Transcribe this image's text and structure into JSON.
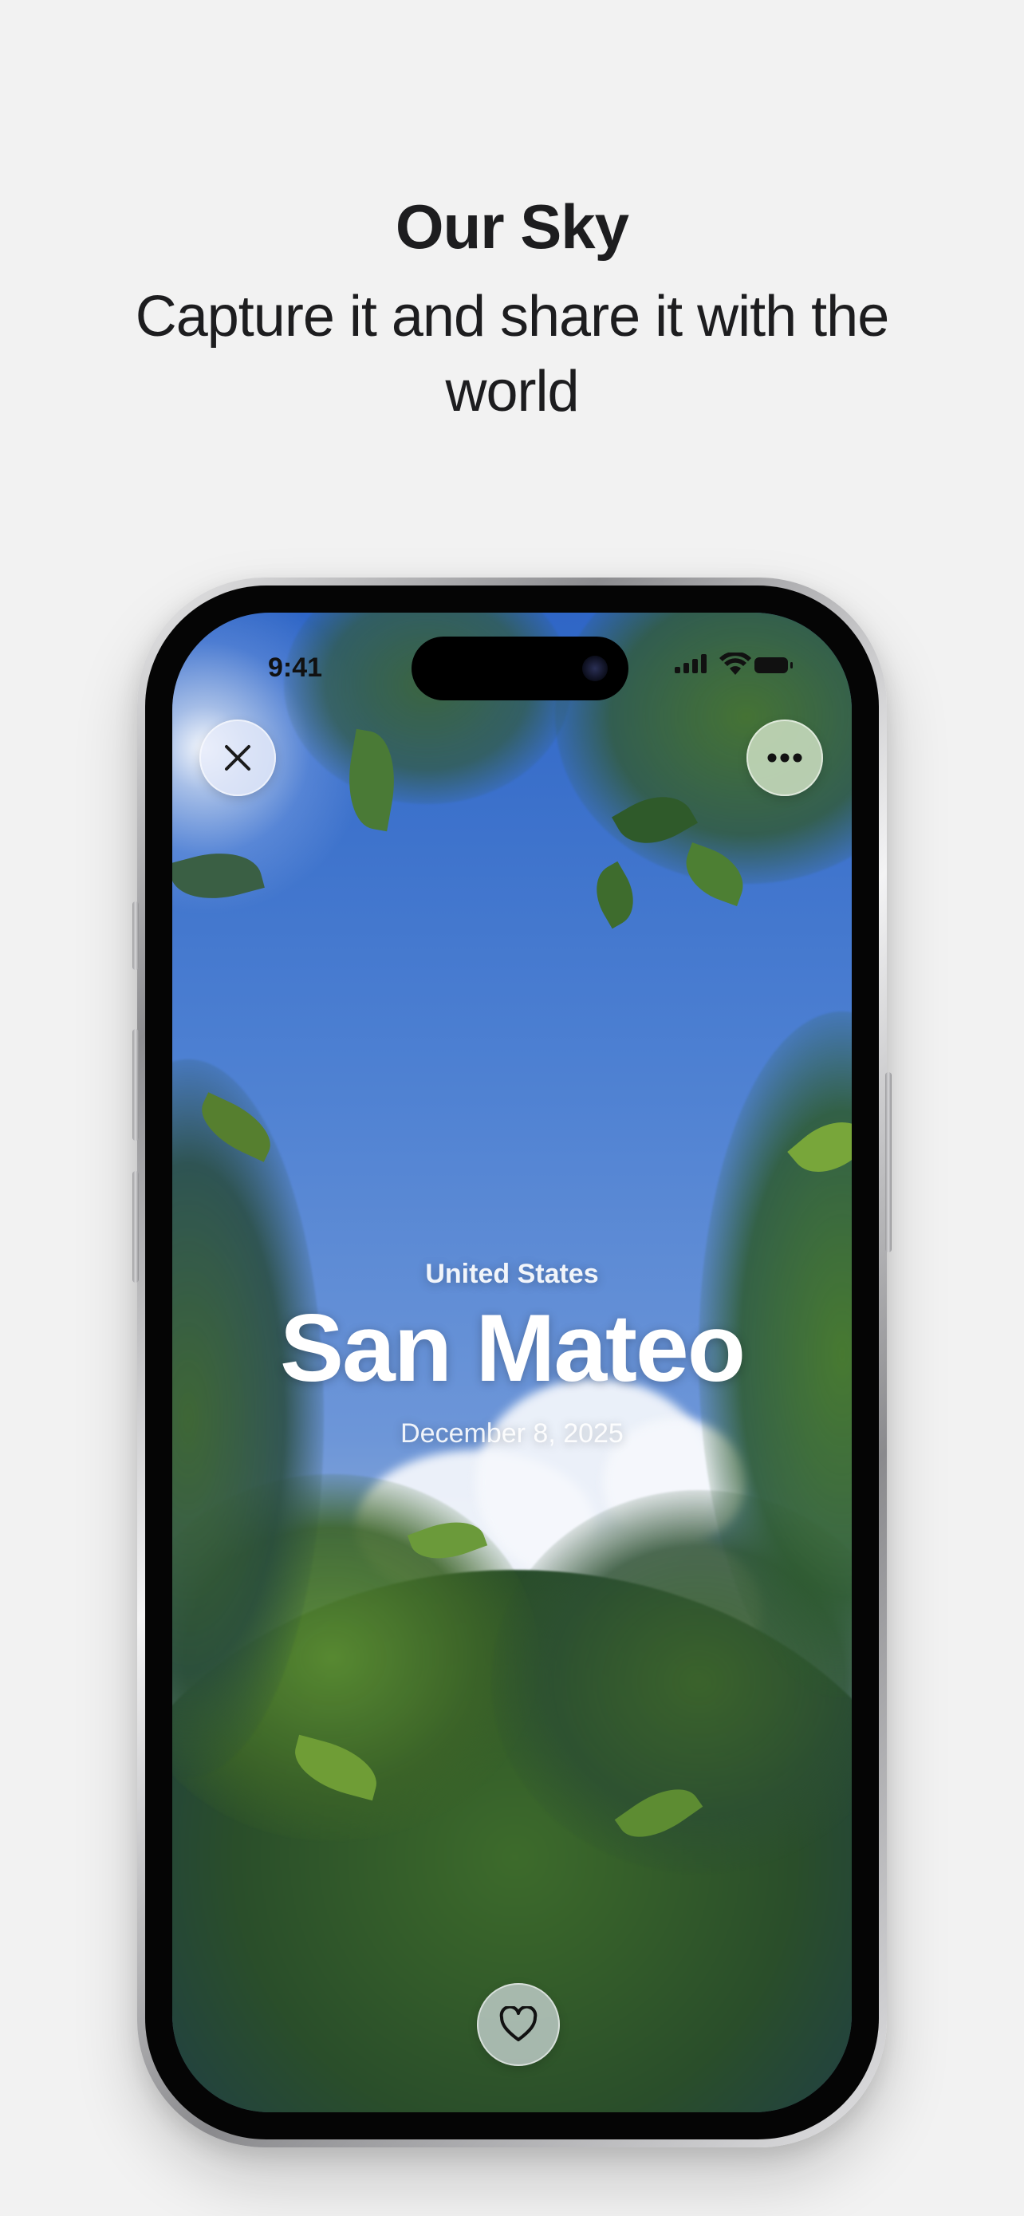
{
  "header": {
    "title": "Our Sky",
    "subtitle": "Capture it and share it with the world"
  },
  "status_bar": {
    "time": "9:41"
  },
  "location": {
    "country": "United States",
    "city": "San Mateo",
    "date": "December 8, 2025"
  },
  "icons": {
    "close": "close-icon",
    "more": "ellipsis-icon",
    "favorite": "heart-icon",
    "signal": "cellular-signal-icon",
    "wifi": "wifi-icon",
    "battery": "battery-icon"
  },
  "colors": {
    "page_background": "#f2f2f2",
    "headline_text": "#1d1d1f",
    "sky_blue": "#4d80d2",
    "foliage_green": "#3f6b2c"
  }
}
